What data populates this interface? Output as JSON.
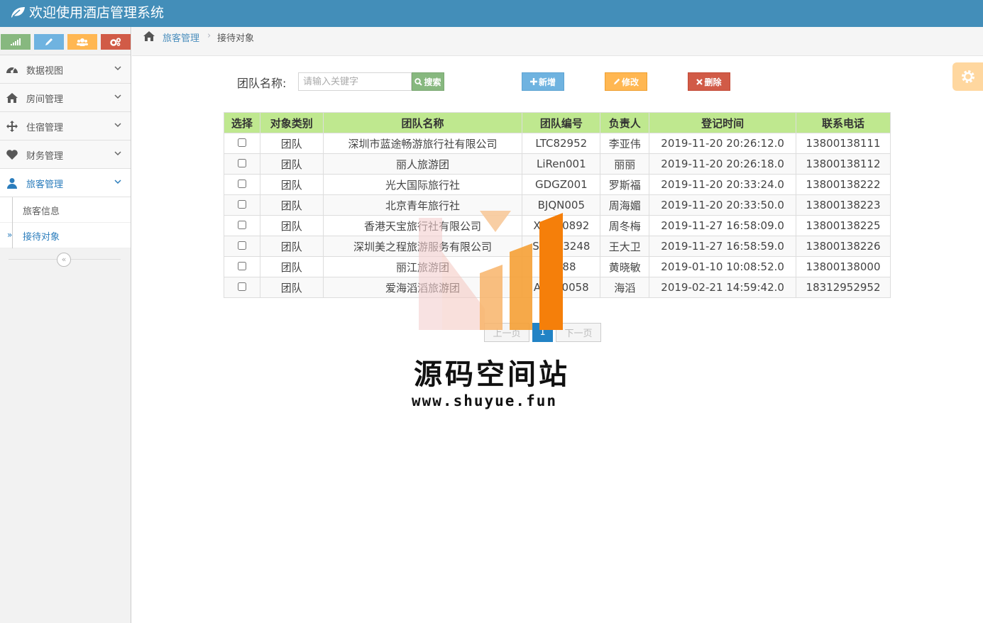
{
  "app": {
    "title": "欢迎使用酒店管理系统"
  },
  "sidebar": {
    "items": [
      {
        "label": "数据视图",
        "icon": "dashboard-icon"
      },
      {
        "label": "房间管理",
        "icon": "home-icon"
      },
      {
        "label": "住宿管理",
        "icon": "move-icon"
      },
      {
        "label": "财务管理",
        "icon": "heart-icon"
      },
      {
        "label": "旅客管理",
        "icon": "user-icon"
      }
    ],
    "subitems": [
      {
        "label": "旅客信息"
      },
      {
        "label": "接待对象"
      }
    ],
    "submenu_arrow": "»",
    "collapse_glyph": "«"
  },
  "breadcrumb": {
    "parent": "旅客管理",
    "separator": "›",
    "current": "接待对象"
  },
  "search": {
    "label": "团队名称:",
    "placeholder": "请输入关键字",
    "value": "",
    "button": "搜索"
  },
  "actions": {
    "add": "新增",
    "edit": "修改",
    "delete": "删除"
  },
  "table": {
    "headers": [
      "选择",
      "对象类别",
      "团队名称",
      "团队编号",
      "负责人",
      "登记时间",
      "联系电话"
    ],
    "rows": [
      {
        "type": "团队",
        "name": "深圳市蓝途畅游旅行社有限公司",
        "code": "LTC82952",
        "leader": "李亚伟",
        "time": "2019-11-20 20:26:12.0",
        "phone": "13800138111"
      },
      {
        "type": "团队",
        "name": "丽人旅游团",
        "code": "LiRen001",
        "leader": "丽丽",
        "time": "2019-11-20 20:26:18.0",
        "phone": "13800138112"
      },
      {
        "type": "团队",
        "name": "光大国际旅行社",
        "code": "GDGZ001",
        "leader": "罗斯福",
        "time": "2019-11-20 20:33:24.0",
        "phone": "13800138222"
      },
      {
        "type": "团队",
        "name": "北京青年旅行社",
        "code": "BJQN005",
        "leader": "周海媚",
        "time": "2019-11-20 20:33:50.0",
        "phone": "13800138223"
      },
      {
        "type": "团队",
        "name": "香港天宝旅行社有限公司",
        "code": "XGTB0892",
        "leader": "周冬梅",
        "time": "2019-11-27 16:58:09.0",
        "phone": "13800138225"
      },
      {
        "type": "团队",
        "name": "深圳美之程旅游服务有限公司",
        "code": "SZMZ3248",
        "leader": "王大卫",
        "time": "2019-11-27 16:58:59.0",
        "phone": "13800138226"
      },
      {
        "type": "团队",
        "name": "丽江旅游团",
        "code": "LJ088",
        "leader": "黄晓敏",
        "time": "2019-01-10 10:08:52.0",
        "phone": "13800138000"
      },
      {
        "type": "团队",
        "name": "爱海滔滔旅游团",
        "code": "AHTT0058",
        "leader": "海滔",
        "time": "2019-02-21 14:59:42.0",
        "phone": "18312952952"
      }
    ]
  },
  "pagination": {
    "prev": "上一页",
    "current": "1",
    "next": "下一页"
  },
  "watermark": {
    "title": "源码空间站",
    "url": "www.shuyue.fun"
  },
  "colors": {
    "header": "#438eb9",
    "table_header": "#bfe88f",
    "add": "#6fb3e0",
    "edit": "#ffb752",
    "delete": "#d15b47",
    "search": "#87b87f"
  }
}
